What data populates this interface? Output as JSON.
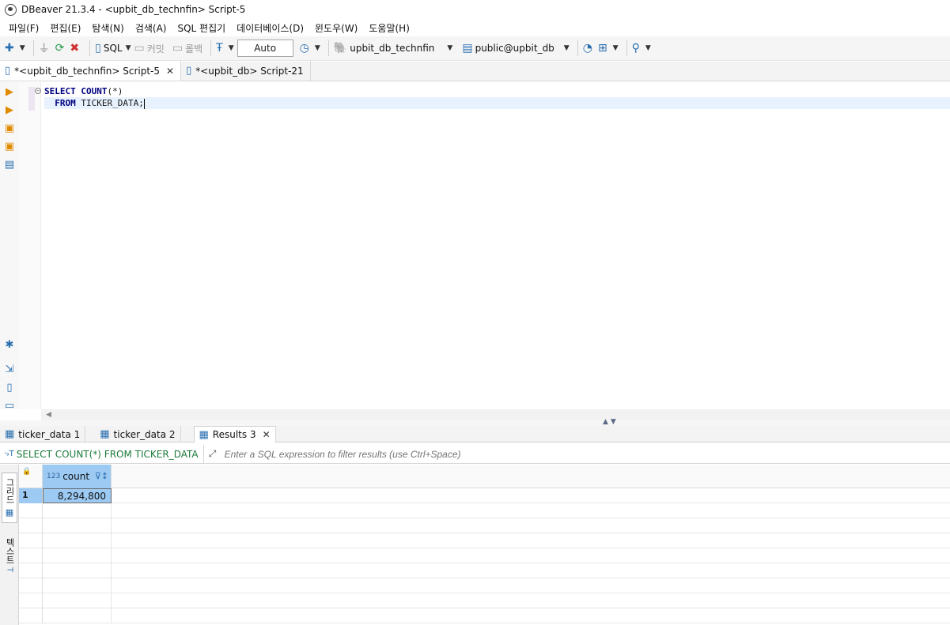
{
  "window": {
    "title": "DBeaver 21.3.4 - <upbit_db_technfin> Script-5"
  },
  "menu": [
    "파일(F)",
    "편집(E)",
    "탐색(N)",
    "검색(A)",
    "SQL 편집기",
    "데이터베이스(D)",
    "윈도우(W)",
    "도움말(H)"
  ],
  "toolbar": {
    "sql_label": "SQL",
    "commit_label": "커밋",
    "rollback_label": "롤백",
    "transaction_mode": "Auto",
    "datasource": "upbit_db_technfin",
    "schema": "public@upbit_db"
  },
  "editor_tabs": [
    {
      "label": "*<upbit_db_technfin> Script-5",
      "active": true
    },
    {
      "label": "*<upbit_db> Script-21",
      "active": false
    }
  ],
  "editor": {
    "lines": [
      {
        "kw1": "SELECT",
        "kw2": "COUNT",
        "rest": "(*)"
      },
      {
        "kw1": "FROM",
        "rest": " TICKER_DATA;"
      }
    ]
  },
  "result_tabs": [
    {
      "label": "ticker_data 1"
    },
    {
      "label": "ticker_data 2"
    },
    {
      "label": "Results 3",
      "active": true
    }
  ],
  "filter": {
    "query": "SELECT COUNT(*) FROM TICKER_DATA",
    "placeholder": "Enter a SQL expression to filter results (use Ctrl+Space)"
  },
  "side_tabs": {
    "grid": "그리드",
    "text": "텍스트"
  },
  "grid": {
    "column_type": "123",
    "column_name": "count",
    "rows": [
      {
        "num": "1",
        "value": "8,294,800"
      }
    ]
  }
}
